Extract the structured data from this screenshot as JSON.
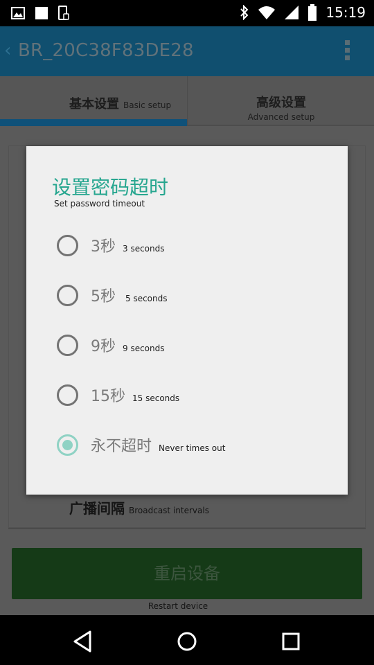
{
  "status_bar": {
    "time": "15:19",
    "icons_left": [
      "image-icon",
      "square-icon",
      "phone-bag-icon"
    ],
    "icons_right": [
      "bluetooth-icon",
      "wifi-icon",
      "signal-icon",
      "battery-icon"
    ]
  },
  "app_bar": {
    "title": "BR_20C38F83DE28",
    "back_icon": "chevron-left-icon",
    "overflow_icon": "more-vert-icon"
  },
  "tabs": [
    {
      "label_cn": "基本设置",
      "label_en": "Basic setup",
      "selected": true
    },
    {
      "label_cn": "高级设置",
      "label_en": "Advanced setup",
      "selected": false
    }
  ],
  "content": {
    "broadcast_cn": "广播间隔",
    "broadcast_en": "Broadcast intervals",
    "restart_cn": "重启设备",
    "restart_en": "Restart device"
  },
  "dialog": {
    "title_cn": "设置密码超时",
    "subtitle_en": "Set password timeout",
    "options": [
      {
        "label_cn": "3秒",
        "label_en": "3 seconds",
        "checked": false
      },
      {
        "label_cn": "5秒",
        "label_en": "5 seconds",
        "checked": false
      },
      {
        "label_cn": "9秒",
        "label_en": "9 seconds",
        "checked": false
      },
      {
        "label_cn": "15秒",
        "label_en": "15 seconds",
        "checked": false
      },
      {
        "label_cn": "永不超时",
        "label_en": "Never times out",
        "checked": true
      }
    ]
  },
  "nav_bar": {
    "icons": [
      "back-triangle-icon",
      "home-circle-icon",
      "recents-square-icon"
    ]
  },
  "colors": {
    "accent": "#26a68f",
    "radio_checked": "#8fd2c4",
    "app_bar": "#104f6f",
    "tab_indicator": "#0f5179"
  }
}
